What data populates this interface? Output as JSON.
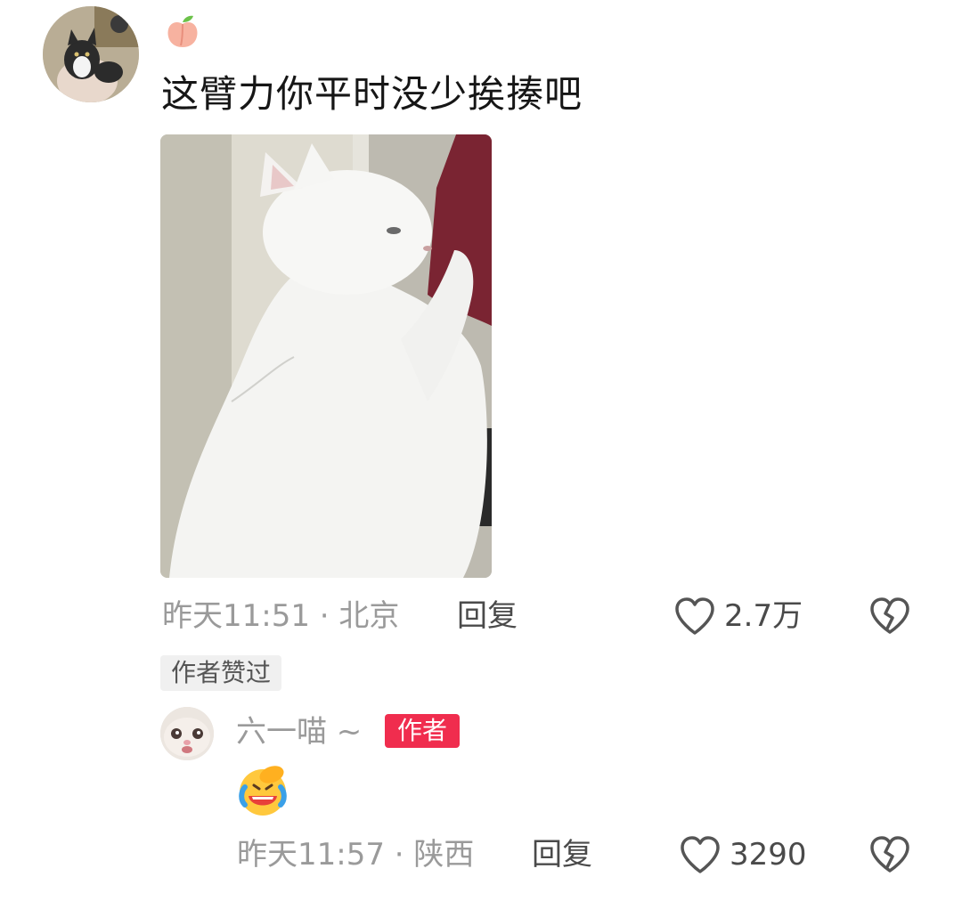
{
  "comment": {
    "avatar_icon": "tuxedo-cat-avatar",
    "name_icon": "peach-emoji-icon",
    "text": "这臂力你平时没少挨揍吧",
    "image_icon": "white-cat-photo",
    "meta": "昨天11:51 · 北京",
    "reply_label": "回复",
    "like_count": "2.7万",
    "like_icon": "heart-outline-icon",
    "dislike_icon": "broken-heart-icon",
    "tag": "作者赞过"
  },
  "reply": {
    "avatar_icon": "kitten-face-avatar",
    "name": "六一喵 ~",
    "badge": "作者",
    "emoji_icon": "laughing-crying-emoji-icon",
    "meta": "昨天11:57 · 陕西",
    "reply_label": "回复",
    "like_count": "3290",
    "like_icon": "heart-outline-icon",
    "dislike_icon": "broken-heart-icon"
  },
  "colors": {
    "accent": "#f02d4e",
    "meta_text": "#9a9a9a",
    "body_text": "#161616"
  }
}
